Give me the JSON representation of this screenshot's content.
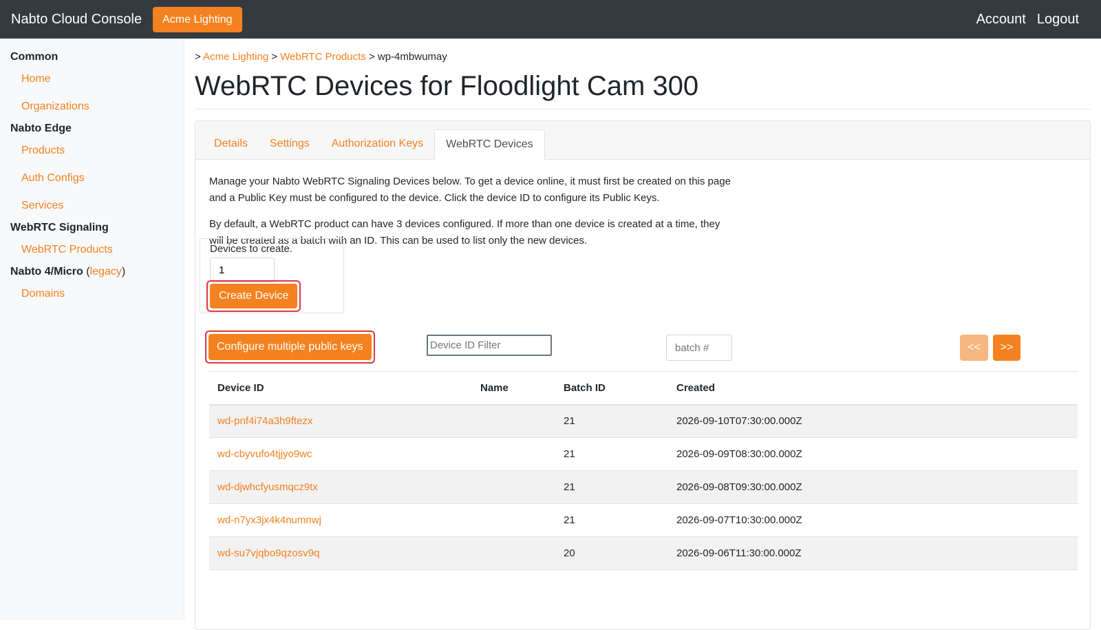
{
  "navbar": {
    "brand": "Nabto Cloud Console",
    "org_button": "Acme Lighting",
    "account": "Account",
    "logout": "Logout"
  },
  "sidebar": {
    "common_heading": "Common",
    "home": "Home",
    "organizations": "Organizations",
    "edge_heading": "Nabto Edge",
    "products": "Products",
    "auth_configs": "Auth Configs",
    "services": "Services",
    "webrtc_heading": "WebRTC Signaling",
    "webrtc_products": "WebRTC Products",
    "legacy_heading": "Nabto 4/Micro",
    "legacy_open": " (",
    "legacy_link": "legacy",
    "legacy_close": ")",
    "domains": "Domains"
  },
  "breadcrumb": {
    "sep": ">",
    "org": "Acme Lighting",
    "products": "WebRTC Products",
    "current": "wp-4mbwumay"
  },
  "page_title": "WebRTC Devices for Floodlight Cam 300",
  "tabs": {
    "details": "Details",
    "settings": "Settings",
    "auth_keys": "Authorization Keys",
    "webrtc_devices": "WebRTC Devices"
  },
  "description": {
    "p1": "Manage your Nabto WebRTC Signaling Devices below. To get a device online, it must first be created on this page and a Public Key must be configured to the device. Click the device ID to configure its Public Keys.",
    "p2": "By default, a WebRTC product can have 3 devices configured. If more than one device is created at a time, they will be created as a batch with an ID. This can be used to list only the new devices."
  },
  "create_form": {
    "label": "Devices to create.",
    "count": "1",
    "button": "Create Device"
  },
  "toolbar": {
    "configure_button": "Configure multiple public keys",
    "filter_placeholder": "Device ID Filter",
    "batch_placeholder": "batch #",
    "prev": "<<",
    "next": ">>"
  },
  "table": {
    "headers": {
      "device_id": "Device ID",
      "name": "Name",
      "batch_id": "Batch ID",
      "created": "Created"
    },
    "rows": [
      {
        "device_id": "wd-pnf4i74a3h9ftezx",
        "name": "",
        "batch_id": "21",
        "created": "2026-09-10T07:30:00.000Z"
      },
      {
        "device_id": "wd-cbyvufo4tjjyo9wc",
        "name": "",
        "batch_id": "21",
        "created": "2026-09-09T08:30:00.000Z"
      },
      {
        "device_id": "wd-djwhcfyusmqcz9tx",
        "name": "",
        "batch_id": "21",
        "created": "2026-09-08T09:30:00.000Z"
      },
      {
        "device_id": "wd-n7yx3jx4k4numnwj",
        "name": "",
        "batch_id": "21",
        "created": "2026-09-07T10:30:00.000Z"
      },
      {
        "device_id": "wd-su7vjqbo9qzosv9q",
        "name": "",
        "batch_id": "20",
        "created": "2026-09-06T11:30:00.000Z"
      }
    ]
  }
}
